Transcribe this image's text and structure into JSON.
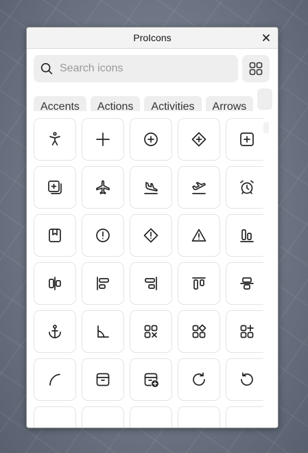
{
  "window": {
    "title": "ProIcons"
  },
  "search": {
    "placeholder": "Search icons",
    "value": ""
  },
  "categories": [
    "Accents",
    "Actions",
    "Activities",
    "Arrows",
    ""
  ],
  "icons": [
    "accessibility-icon",
    "add-icon",
    "add-circle-icon",
    "add-diamond-icon",
    "add-square-icon",
    "add-square-multiple-icon",
    "airplane-icon",
    "airplane-landing-icon",
    "airplane-takeoff-icon",
    "alarm-clock-icon",
    "bookmark-box-icon",
    "alert-circle-icon",
    "alert-diamond-icon",
    "alert-triangle-icon",
    "align-bottom-icon",
    "align-horizontal-center-icon",
    "align-left-icon",
    "align-right-icon",
    "align-top-icon",
    "align-vertical-center-icon",
    "anchor-icon",
    "angle-icon",
    "apps-remove-icon",
    "apps-icon",
    "apps-add-icon",
    "arc-icon",
    "archive-icon",
    "archive-add-icon",
    "arrow-clockwise-icon",
    "arrow-counterclockwise-icon",
    "partial-icon",
    "partial-icon",
    "partial-icon",
    "partial-icon",
    "partial-icon"
  ]
}
